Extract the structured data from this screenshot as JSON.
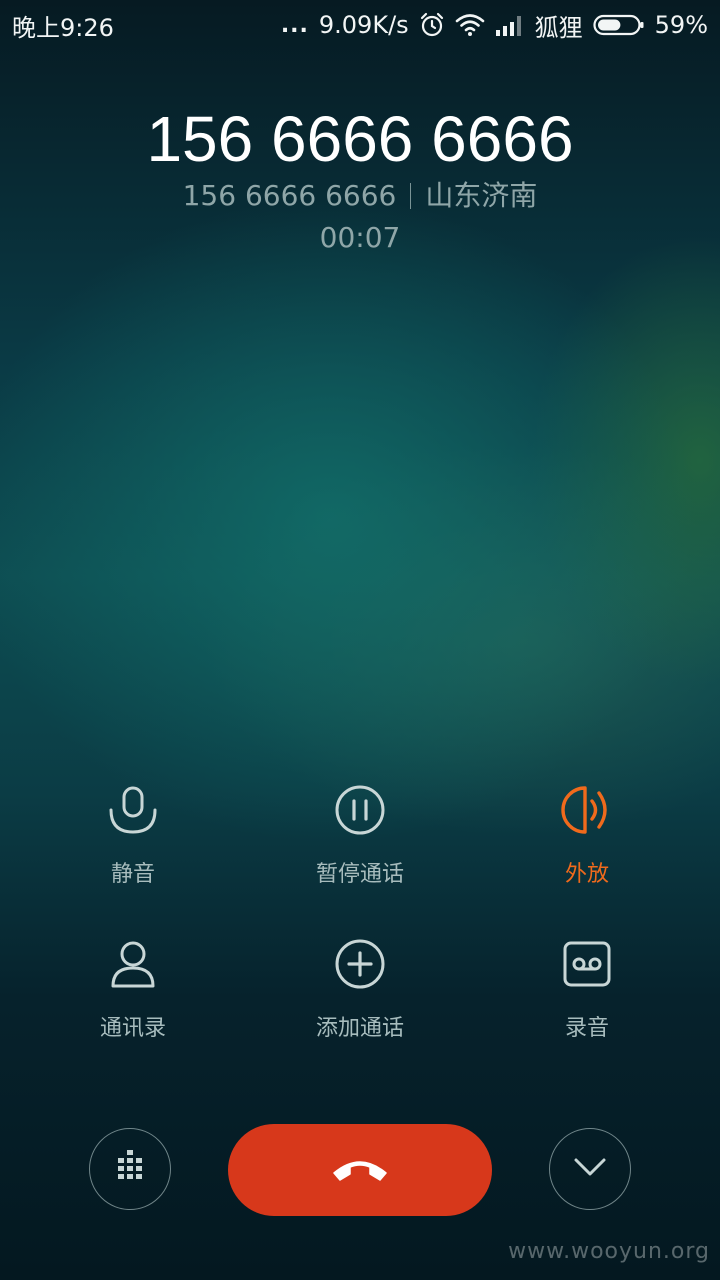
{
  "status_bar": {
    "time": "晚上9:26",
    "more": "...",
    "network_speed": "9.09K/s",
    "carrier": "狐狸",
    "battery_percent": "59%",
    "battery_level": 0.59,
    "icons": [
      "alarm-icon",
      "wifi-icon",
      "signal-icon",
      "battery-icon"
    ]
  },
  "call": {
    "number": "156 6666 6666",
    "sub_number": "156 6666 6666",
    "location": "山东济南",
    "duration": "00:07"
  },
  "actions": [
    {
      "label": "静音",
      "icon": "microphone-icon",
      "active": false
    },
    {
      "label": "暂停通话",
      "icon": "pause-icon",
      "active": false
    },
    {
      "label": "外放",
      "icon": "speaker-icon",
      "active": true
    },
    {
      "label": "通讯录",
      "icon": "contact-icon",
      "active": false
    },
    {
      "label": "添加通话",
      "icon": "add-call-icon",
      "active": false
    },
    {
      "label": "录音",
      "icon": "record-icon",
      "active": false
    }
  ],
  "bottom": {
    "dialpad_icon": "dialpad-icon",
    "hangup_icon": "hangup-icon",
    "collapse_icon": "chevron-down-icon"
  },
  "colors": {
    "active": "#f06a1c",
    "hangup": "#d7381b",
    "icon": "#c8d6d6"
  },
  "watermark": "www.wooyun.org"
}
